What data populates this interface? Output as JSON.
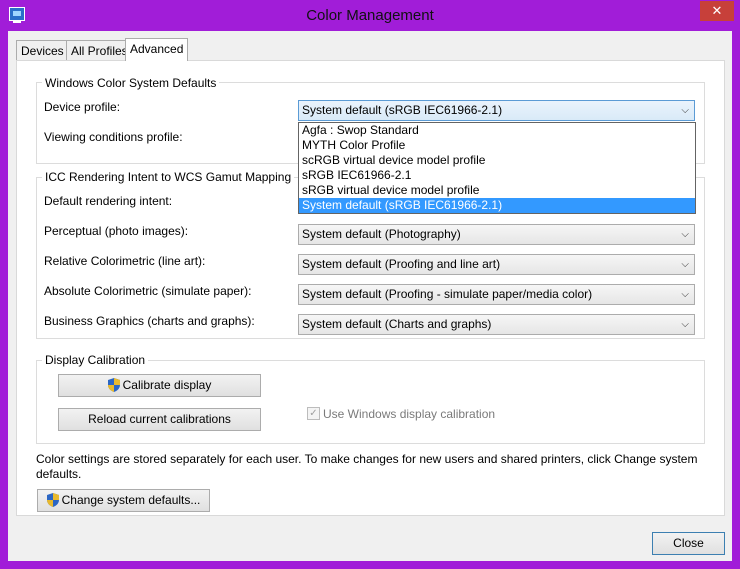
{
  "window": {
    "title": "Color Management",
    "close_glyph": "✕"
  },
  "tabs": [
    {
      "label": "Devices"
    },
    {
      "label": "All Profiles"
    },
    {
      "label": "Advanced",
      "active": true
    }
  ],
  "wcs": {
    "title": "Windows Color System Defaults",
    "device_profile_label": "Device profile:",
    "device_profile_value": "System default (sRGB IEC61966-2.1)",
    "viewing_conditions_label": "Viewing conditions profile:",
    "dropdown_options": [
      "Agfa : Swop Standard",
      "MYTH Color Profile",
      "scRGB virtual device model profile",
      "sRGB IEC61966-2.1",
      "sRGB virtual device model profile",
      "System default (sRGB IEC61966-2.1)"
    ],
    "dropdown_selected_index": 5
  },
  "icc": {
    "title": "ICC Rendering Intent to WCS Gamut Mapping",
    "default_label": "Default rendering intent:",
    "perceptual_label": "Perceptual (photo images):",
    "perceptual_value": "System default (Photography)",
    "relative_label": "Relative Colorimetric (line art):",
    "relative_value": "System default (Proofing and line art)",
    "absolute_label": "Absolute Colorimetric (simulate paper):",
    "absolute_value": "System default (Proofing - simulate paper/media color)",
    "business_label": "Business Graphics (charts and graphs):",
    "business_value": "System default (Charts and graphs)"
  },
  "calibration": {
    "title": "Display Calibration",
    "calibrate_label": "Calibrate display",
    "reload_label": "Reload current calibrations",
    "use_windows_label": "Use Windows display calibration",
    "use_windows_checked": true
  },
  "footer": {
    "info_text": "Color settings are stored separately for each user. To make changes for new users and shared printers, click Change system defaults.",
    "change_defaults_label": "Change system defaults...",
    "close_label": "Close"
  },
  "icons": {
    "app": "color-management-monitor-icon",
    "shield": "uac-shield-icon",
    "chevron": "chevron-down-icon"
  },
  "colors": {
    "accent": "#a11dd8",
    "selection": "#3399ff",
    "close_button": "#c7403a"
  }
}
